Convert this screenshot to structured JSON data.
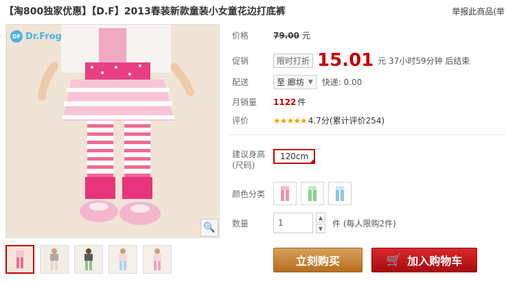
{
  "product": {
    "title": "【淘800独家优惠】【D.F】2013春装新款童装小女童花边打底裤",
    "report_label": "举报此商品(举"
  },
  "gallery": {
    "logo_badge": "DF",
    "logo_text": "Dr.Frog",
    "zoom_icon": "magnifier-icon",
    "thumbnail_count": 5
  },
  "price": {
    "label": "价格",
    "original": "79.00",
    "currency": "元"
  },
  "promo": {
    "label": "促销",
    "tag": "限时打折",
    "price": "15.01",
    "countdown": "元 37小时59分钟 后结束"
  },
  "shipping": {
    "label": "配送",
    "location": "至 廊坊",
    "fee": "快递: 0.00"
  },
  "sales": {
    "label": "月销量",
    "count": "1122",
    "unit": "件"
  },
  "rating": {
    "label": "评价",
    "stars": "★★★★★",
    "text": "4.7分(累计评价254)"
  },
  "size": {
    "label_line1": "建议身高",
    "label_line2": "(尺码)",
    "selected": "120cm"
  },
  "colors": {
    "label": "颜色分类"
  },
  "quantity": {
    "label": "数量",
    "value": "1",
    "note": "件 (每人限购2件)"
  },
  "actions": {
    "buy_now": "立刻购买",
    "add_to_cart": "加入购物车"
  },
  "theme": {
    "accent": "#c40000",
    "buy": "#c0782a",
    "cart": "#c01418"
  }
}
